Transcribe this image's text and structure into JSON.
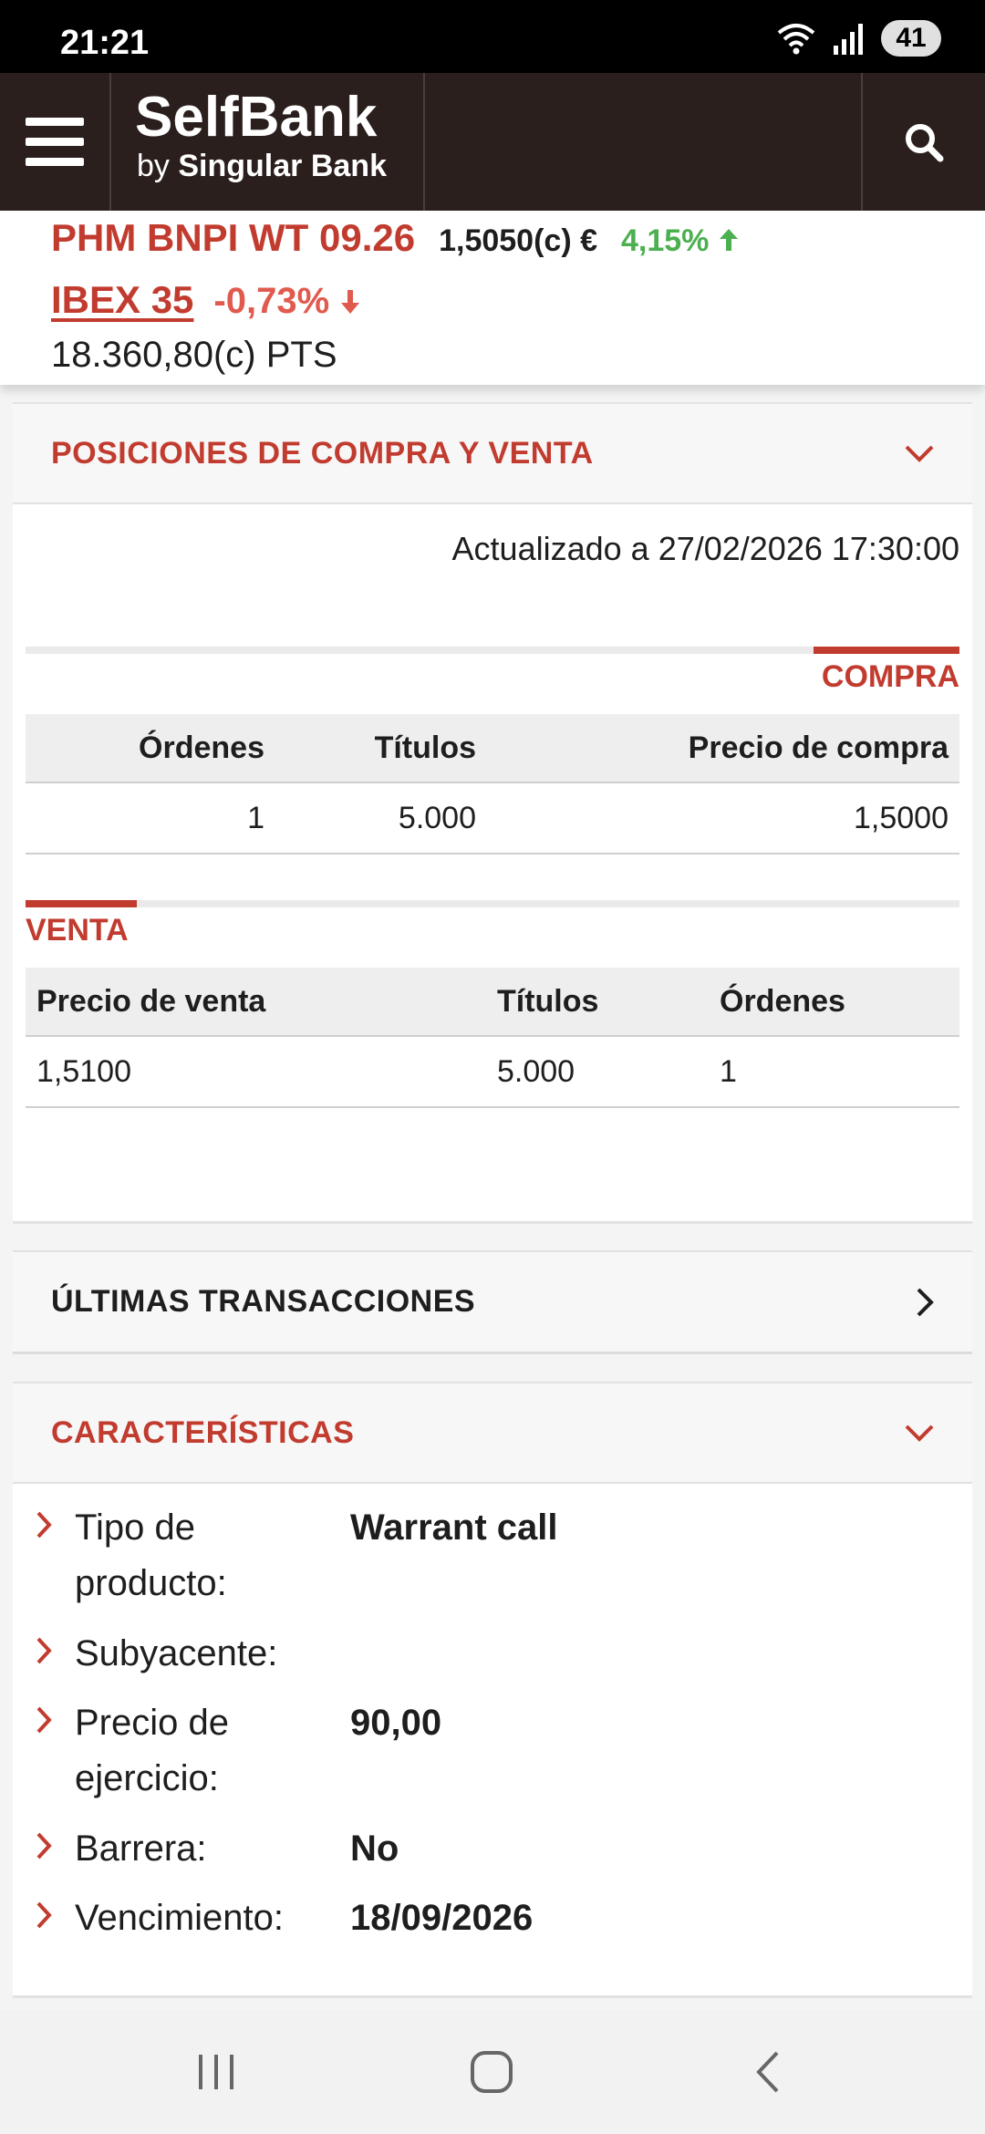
{
  "status_bar": {
    "time": "21:21",
    "battery": "41",
    "icons": [
      "wifi-icon",
      "signal-icon"
    ]
  },
  "header": {
    "logo_main": "SelfBank",
    "logo_by": "by",
    "logo_bank": "Singular Bank",
    "icons": [
      "menu-icon",
      "search-icon"
    ]
  },
  "ticker": {
    "name": "PHM BNPI WT 09.26",
    "price": "1,5050(c) €",
    "change": "4,15%",
    "change_direction": "up",
    "index_name": "IBEX 35",
    "index_change": "-0,73%",
    "index_direction": "down",
    "index_value": "18.360,80(c) PTS"
  },
  "positions": {
    "title": "POSICIONES DE COMPRA Y VENTA",
    "updated": "Actualizado a 27/02/2026 17:30:00",
    "buy": {
      "label": "COMPRA",
      "headers": [
        "Órdenes",
        "Títulos",
        "Precio de compra"
      ],
      "rows": [
        [
          "1",
          "5.000",
          "1,5000"
        ]
      ]
    },
    "sell": {
      "label": "VENTA",
      "headers": [
        "Precio de venta",
        "Títulos",
        "Órdenes"
      ],
      "rows": [
        [
          "1,5100",
          "5.000",
          "1"
        ]
      ]
    }
  },
  "transactions": {
    "title": "ÚLTIMAS TRANSACCIONES"
  },
  "characteristics": {
    "title": "CARACTERÍSTICAS",
    "items": [
      {
        "label": "Tipo de producto:",
        "value": "Warrant call"
      },
      {
        "label": "Subyacente:",
        "value": ""
      },
      {
        "label": "Precio de ejercicio:",
        "value": "90,00"
      },
      {
        "label": "Barrera:",
        "value": "No"
      },
      {
        "label": "Vencimiento:",
        "value": "18/09/2026"
      }
    ]
  },
  "colors": {
    "brand_red": "#c23b2f",
    "header_bg": "#2a1f1d",
    "up_green": "#4caf50",
    "down_red": "#e05a4e"
  }
}
